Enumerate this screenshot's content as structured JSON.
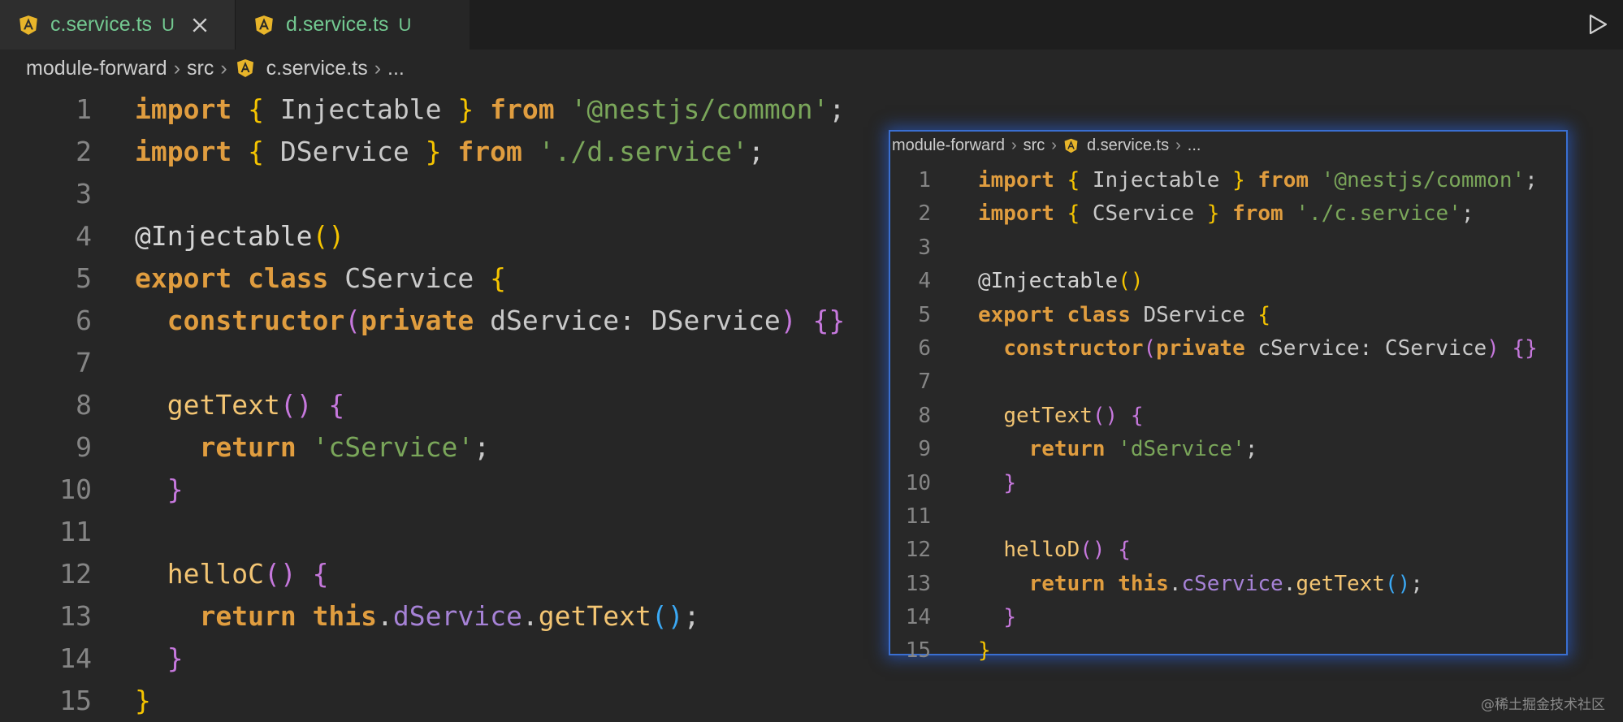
{
  "tabs": [
    {
      "label": "c.service.ts",
      "badge": "U",
      "active": true
    },
    {
      "label": "d.service.ts",
      "badge": "U",
      "active": false
    }
  ],
  "breadcrumb": {
    "parts": [
      "module-forward",
      "src",
      "c.service.ts",
      "..."
    ]
  },
  "peek_breadcrumb": {
    "parts": [
      "module-forward",
      "src",
      "d.service.ts",
      "..."
    ]
  },
  "editor": {
    "line_numbers": [
      "1",
      "2",
      "3",
      "4",
      "5",
      "6",
      "7",
      "8",
      "9",
      "10",
      "11",
      "12",
      "13",
      "14",
      "15"
    ],
    "lines": [
      [
        [
          "kw",
          "import "
        ],
        [
          "br",
          "{ "
        ],
        [
          "plain",
          "Injectable "
        ],
        [
          "br",
          "} "
        ],
        [
          "kw",
          "from "
        ],
        [
          "str",
          "'@nestjs/common'"
        ],
        [
          "plain",
          ";"
        ]
      ],
      [
        [
          "kw",
          "import "
        ],
        [
          "br",
          "{ "
        ],
        [
          "plain",
          "DService "
        ],
        [
          "br",
          "} "
        ],
        [
          "kw",
          "from "
        ],
        [
          "str",
          "'./d.service'"
        ],
        [
          "plain",
          ";"
        ]
      ],
      [],
      [
        [
          "deco",
          "@Injectable"
        ],
        [
          "br",
          "()"
        ]
      ],
      [
        [
          "kw",
          "export "
        ],
        [
          "kw",
          "class "
        ],
        [
          "plain",
          "CService "
        ],
        [
          "br",
          "{"
        ]
      ],
      [
        [
          "plain",
          "  "
        ],
        [
          "kw",
          "constructor"
        ],
        [
          "br2",
          "("
        ],
        [
          "kw",
          "private "
        ],
        [
          "plain",
          "dService: DService"
        ],
        [
          "br2",
          ")"
        ],
        [
          "plain",
          " "
        ],
        [
          "br2",
          "{}"
        ]
      ],
      [],
      [
        [
          "plain",
          "  "
        ],
        [
          "fn",
          "getText"
        ],
        [
          "br2",
          "() {"
        ]
      ],
      [
        [
          "plain",
          "    "
        ],
        [
          "kw",
          "return "
        ],
        [
          "str",
          "'cService'"
        ],
        [
          "plain",
          ";"
        ]
      ],
      [
        [
          "plain",
          "  "
        ],
        [
          "br2",
          "}"
        ]
      ],
      [],
      [
        [
          "plain",
          "  "
        ],
        [
          "fn",
          "helloC"
        ],
        [
          "br2",
          "() {"
        ]
      ],
      [
        [
          "plain",
          "    "
        ],
        [
          "kw",
          "return "
        ],
        [
          "kw",
          "this"
        ],
        [
          "plain",
          "."
        ],
        [
          "prop",
          "dService"
        ],
        [
          "plain",
          "."
        ],
        [
          "fn",
          "getText"
        ],
        [
          "br3",
          "()"
        ],
        [
          "plain",
          ";"
        ]
      ],
      [
        [
          "plain",
          "  "
        ],
        [
          "br2",
          "}"
        ]
      ],
      [
        [
          "br",
          "}"
        ]
      ]
    ]
  },
  "peek": {
    "line_numbers": [
      "1",
      "2",
      "3",
      "4",
      "5",
      "6",
      "7",
      "8",
      "9",
      "10",
      "11",
      "12",
      "13",
      "14",
      "15"
    ],
    "lines": [
      [
        [
          "kw",
          "import "
        ],
        [
          "br",
          "{ "
        ],
        [
          "plain",
          "Injectable "
        ],
        [
          "br",
          "} "
        ],
        [
          "kw",
          "from "
        ],
        [
          "str",
          "'@nestjs/common'"
        ],
        [
          "plain",
          ";"
        ]
      ],
      [
        [
          "kw",
          "import "
        ],
        [
          "br",
          "{ "
        ],
        [
          "plain",
          "CService "
        ],
        [
          "br",
          "} "
        ],
        [
          "kw",
          "from "
        ],
        [
          "str",
          "'./c.service'"
        ],
        [
          "plain",
          ";"
        ]
      ],
      [],
      [
        [
          "deco",
          "@Injectable"
        ],
        [
          "br",
          "()"
        ]
      ],
      [
        [
          "kw",
          "export "
        ],
        [
          "kw",
          "class "
        ],
        [
          "plain",
          "DService "
        ],
        [
          "br",
          "{"
        ]
      ],
      [
        [
          "plain",
          "  "
        ],
        [
          "kw",
          "constructor"
        ],
        [
          "br2",
          "("
        ],
        [
          "kw",
          "private "
        ],
        [
          "plain",
          "cService: CService"
        ],
        [
          "br2",
          ")"
        ],
        [
          "plain",
          " "
        ],
        [
          "br2",
          "{}"
        ]
      ],
      [],
      [
        [
          "plain",
          "  "
        ],
        [
          "fn",
          "getText"
        ],
        [
          "br2",
          "() {"
        ]
      ],
      [
        [
          "plain",
          "    "
        ],
        [
          "kw",
          "return "
        ],
        [
          "str",
          "'dService'"
        ],
        [
          "plain",
          ";"
        ]
      ],
      [
        [
          "plain",
          "  "
        ],
        [
          "br2",
          "}"
        ]
      ],
      [],
      [
        [
          "plain",
          "  "
        ],
        [
          "fn",
          "helloD"
        ],
        [
          "br2",
          "() {"
        ]
      ],
      [
        [
          "plain",
          "    "
        ],
        [
          "kw",
          "return "
        ],
        [
          "kw",
          "this"
        ],
        [
          "plain",
          "."
        ],
        [
          "prop",
          "cService"
        ],
        [
          "plain",
          "."
        ],
        [
          "fn",
          "getText"
        ],
        [
          "br3",
          "()"
        ],
        [
          "plain",
          ";"
        ]
      ],
      [
        [
          "plain",
          "  "
        ],
        [
          "br2",
          "}"
        ]
      ],
      [
        [
          "br",
          "}"
        ]
      ]
    ]
  },
  "watermark": "@稀土掘金技术社区",
  "colors": {
    "keyword": "#e09d3f",
    "bracket": "#f5c400",
    "string": "#7aa65a",
    "tab_modified": "#73c991",
    "peek_border": "#3a6fd1"
  }
}
